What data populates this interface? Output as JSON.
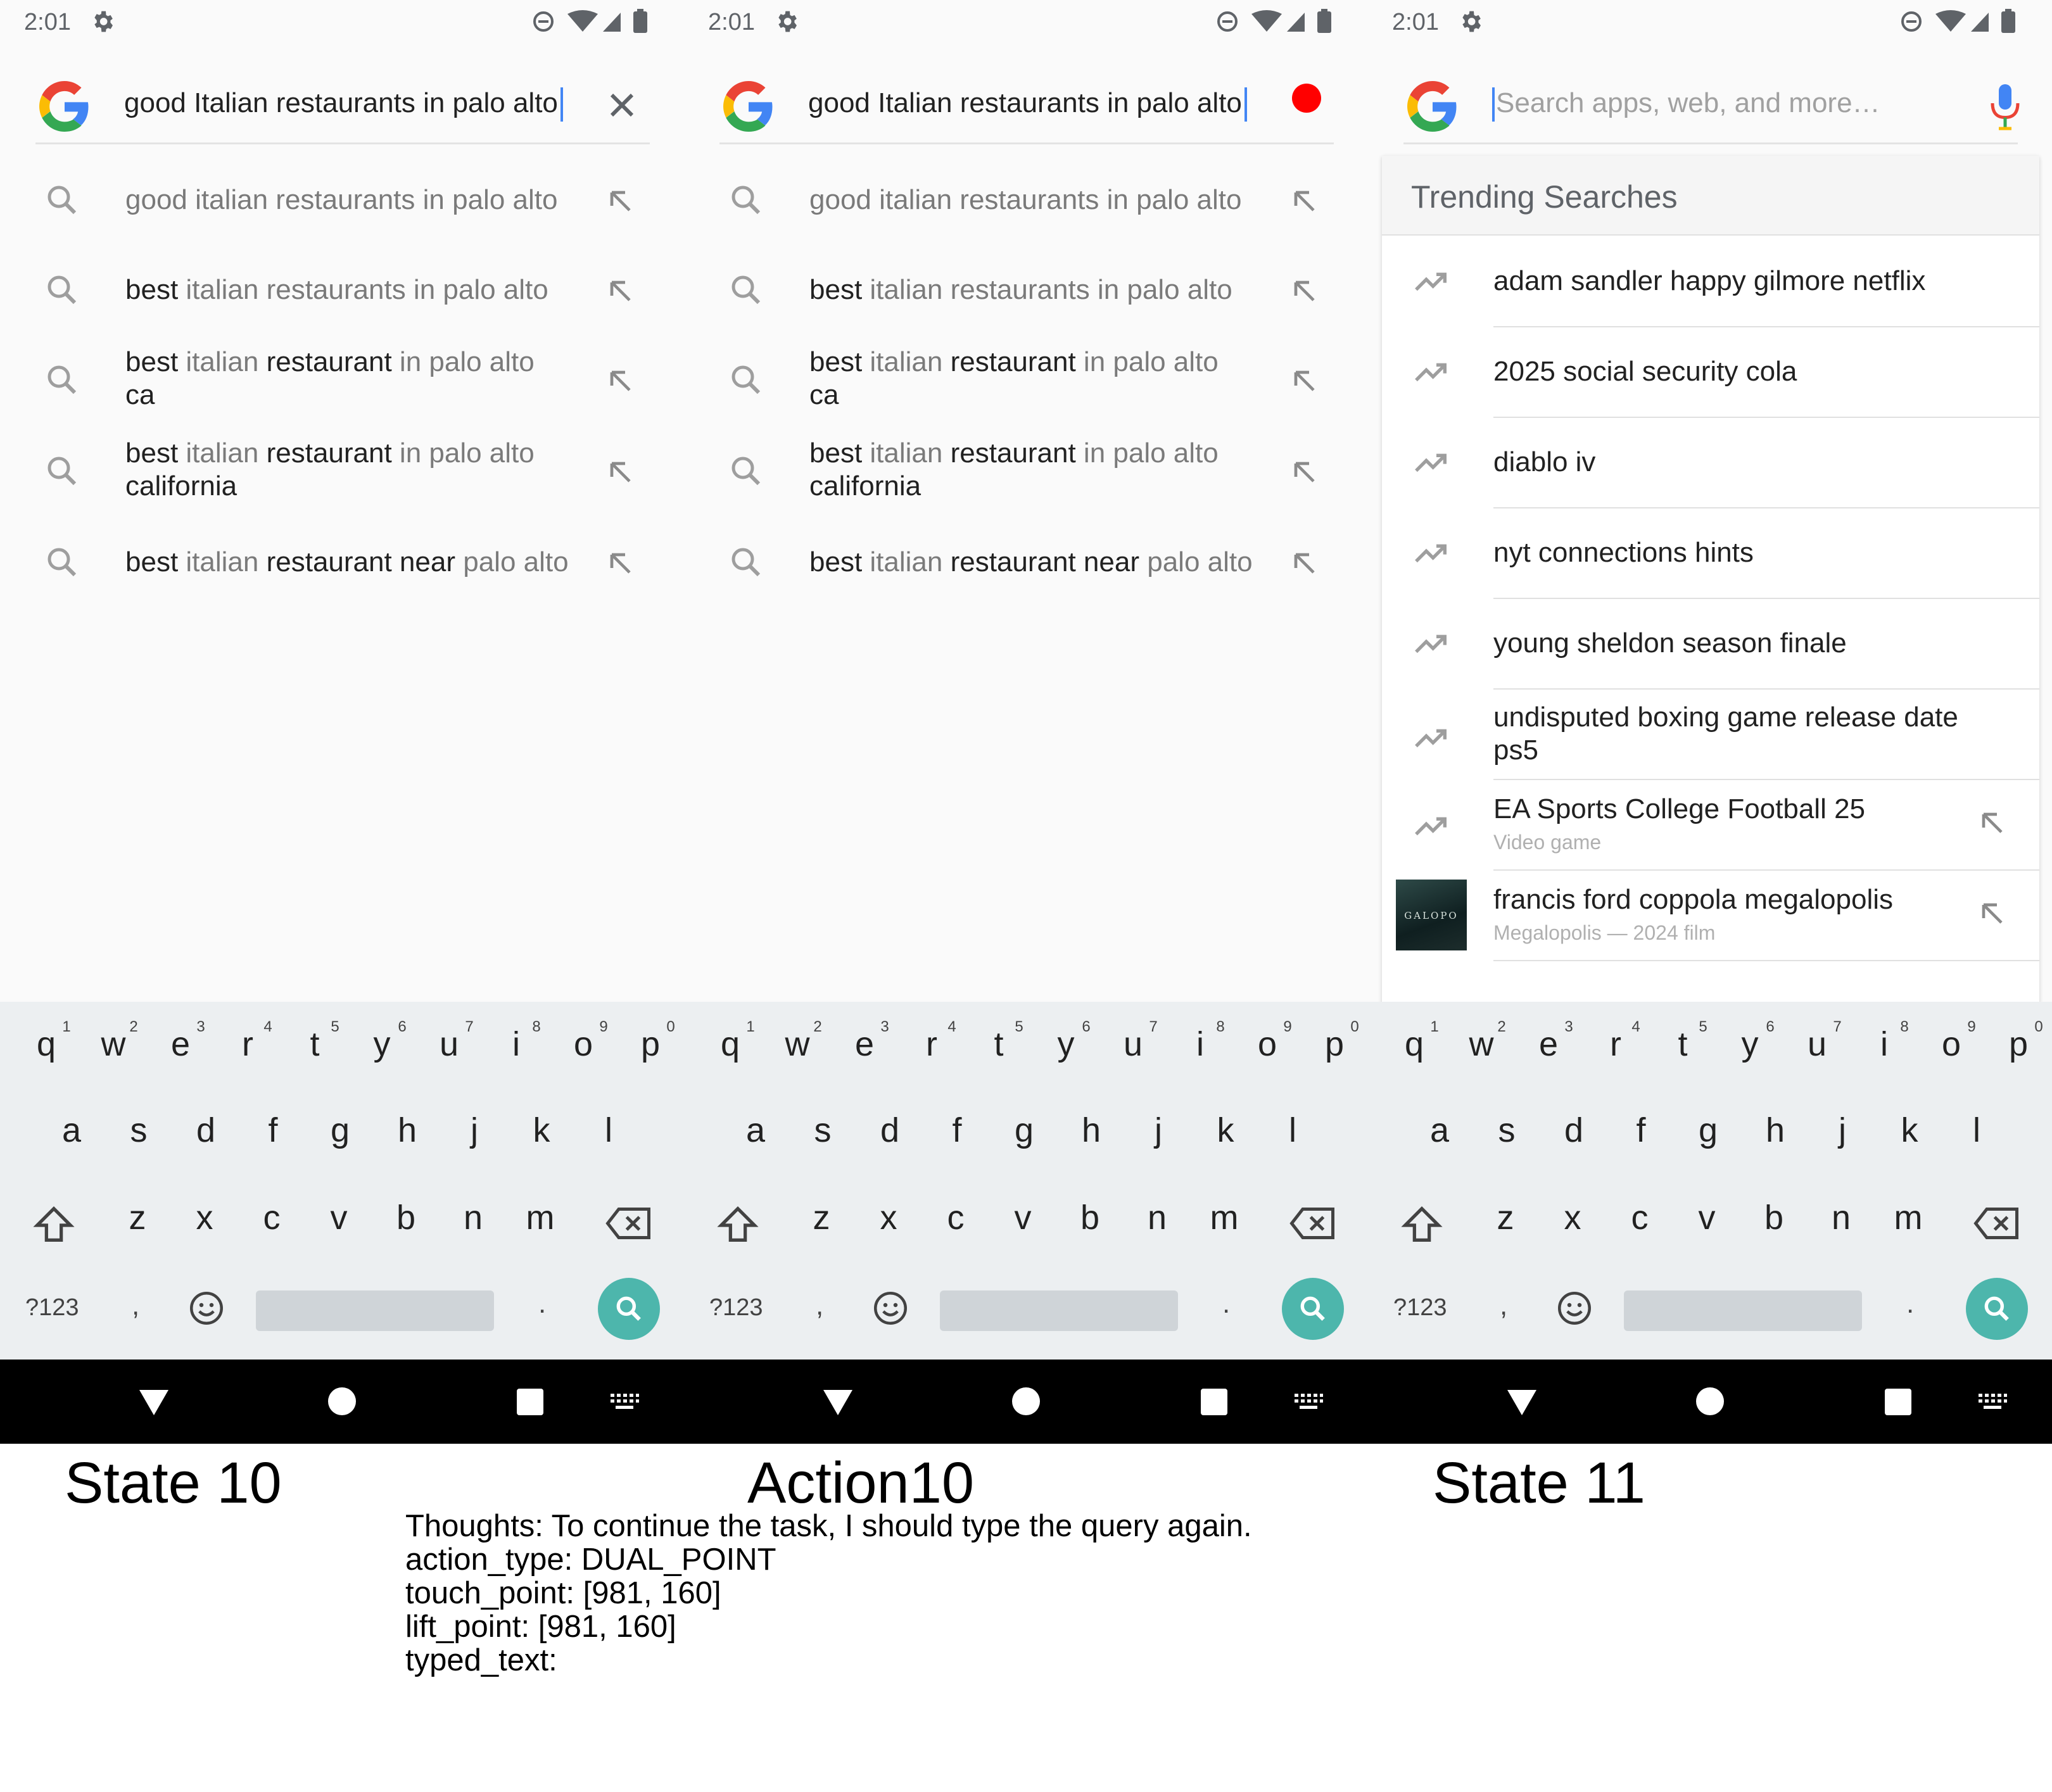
{
  "status": {
    "time": "2:01"
  },
  "panels": [
    {
      "caption": "State 10",
      "query": "good Italian restaurants in palo alto",
      "suggestions": [
        {
          "bold1": "",
          "rest1": "good italian restaurants in palo alto",
          "bold2": "",
          "rest2": "",
          "line2": ""
        },
        {
          "bold1": "best",
          "rest1": " italian restaurants in palo alto",
          "bold2": "",
          "rest2": "",
          "line2": ""
        },
        {
          "bold1": "best",
          "rest1": " italian ",
          "bold2": "restaurant",
          "rest2": " in palo alto",
          "line2": "ca"
        },
        {
          "bold1": "best",
          "rest1": " italian ",
          "bold2": "restaurant",
          "rest2": " in palo alto",
          "line2": "california"
        },
        {
          "bold1": "best",
          "rest1": " italian ",
          "bold2": "restaurant near",
          "rest2": " palo alto",
          "line2": ""
        }
      ]
    },
    {
      "caption": "Action10",
      "query": "good Italian restaurants in palo alto",
      "suggestions": [
        {
          "bold1": "",
          "rest1": "good italian restaurants in palo alto",
          "bold2": "",
          "rest2": "",
          "line2": ""
        },
        {
          "bold1": "best",
          "rest1": " italian restaurants in palo alto",
          "bold2": "",
          "rest2": "",
          "line2": ""
        },
        {
          "bold1": "best",
          "rest1": " italian ",
          "bold2": "restaurant",
          "rest2": " in palo alto",
          "line2": "ca"
        },
        {
          "bold1": "best",
          "rest1": " italian ",
          "bold2": "restaurant",
          "rest2": " in palo alto",
          "line2": "california"
        },
        {
          "bold1": "best",
          "rest1": " italian ",
          "bold2": "restaurant near",
          "rest2": " palo alto",
          "line2": ""
        }
      ]
    },
    {
      "caption": "State 11",
      "placeholder": "Search apps, web, and more…",
      "trending_title": "Trending Searches",
      "trending": [
        {
          "text": "adam sandler happy gilmore netflix",
          "sub": ""
        },
        {
          "text": "2025 social security cola",
          "sub": ""
        },
        {
          "text": "diablo iv",
          "sub": ""
        },
        {
          "text": "nyt connections hints",
          "sub": ""
        },
        {
          "text": "young sheldon season finale",
          "sub": ""
        },
        {
          "text": "undisputed boxing game release date ps5",
          "sub": ""
        },
        {
          "text": "EA Sports College Football 25",
          "sub": "Video game"
        },
        {
          "text": "francis ford coppola megalopolis",
          "sub": "Megalopolis — 2024 film",
          "thumb_text": "GALOPO"
        }
      ]
    }
  ],
  "keyboard": {
    "row1": [
      "q",
      "w",
      "e",
      "r",
      "t",
      "y",
      "u",
      "i",
      "o",
      "p"
    ],
    "row1_hints": [
      "1",
      "2",
      "3",
      "4",
      "5",
      "6",
      "7",
      "8",
      "9",
      "0"
    ],
    "row2": [
      "a",
      "s",
      "d",
      "f",
      "g",
      "h",
      "j",
      "k",
      "l"
    ],
    "row3": [
      "z",
      "x",
      "c",
      "v",
      "b",
      "n",
      "m"
    ],
    "symbols_label": "?123",
    "comma": ",",
    "period": "."
  },
  "action": {
    "thoughts": "Thoughts: To continue the task, I should type the query again.",
    "action_type": "action_type: DUAL_POINT",
    "touch_point": "touch_point: [981, 160]",
    "lift_point": "lift_point: [981, 160]",
    "typed_text": "typed_text:"
  },
  "colors": {
    "accent": "#4285f4",
    "keyboard_bg": "#eceff1",
    "search_key": "#4db6ac",
    "tap_marker": "#ff0000"
  }
}
